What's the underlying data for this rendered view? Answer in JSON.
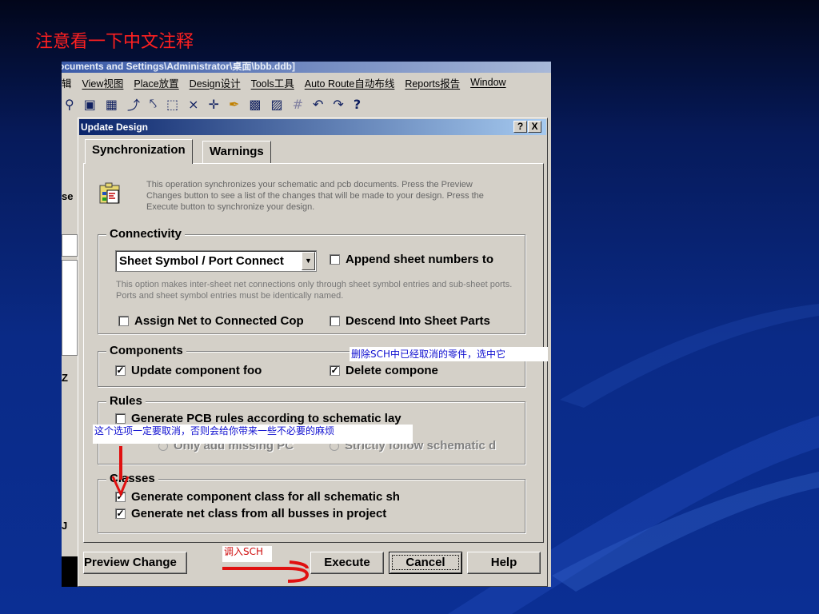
{
  "slide": {
    "title": "注意看一下中文注释"
  },
  "app": {
    "title_path": "ocuments and Settings\\Administrator\\桌面\\bbb.ddb]",
    "menu": [
      "辑",
      "View视图",
      "Place放置",
      "Design设计",
      "Tools工具",
      "Auto Route自动布线",
      "Reports报告",
      "Window"
    ],
    "left_tabs": [
      "se",
      "Z",
      "J"
    ]
  },
  "dialog": {
    "title": "Update Design",
    "help_btn": "?",
    "close_btn": "X",
    "tabs": [
      "Synchronization",
      "Warnings"
    ],
    "intro": "This operation synchronizes your schematic and pcb documents.  Press the Preview Changes button to see a list of the changes that will be made to your design.  Press the Execute button to synchronize your design.",
    "connectivity": {
      "legend": "Connectivity",
      "dropdown_value": "Sheet Symbol / Port Connect",
      "append_sheet": "Append sheet numbers to",
      "note": "This option makes inter-sheet net connections only through sheet symbol entries and sub-sheet ports. Ports and sheet symbol entries must be identically named.",
      "assign_net": "Assign Net to Connected Cop",
      "descend": "Descend Into Sheet Parts"
    },
    "components": {
      "legend": "Components",
      "update_footprint": "Update component foo",
      "delete_components": "Delete compone"
    },
    "rules": {
      "legend": "Rules",
      "generate_pcb_rules": "Generate PCB rules according to schematic lay",
      "only_missing": "Only add missing PC",
      "strictly_follow": "Strictly follow schematic d"
    },
    "classes": {
      "legend": "Classes",
      "component_class": "Generate component class for all schematic sh",
      "net_class": "Generate net class from all busses in project"
    },
    "buttons": {
      "preview": "Preview Change",
      "execute": "Execute",
      "cancel": "Cancel",
      "help": "Help"
    }
  },
  "annotations": {
    "delete_note": "删除SCH中已经取消的零件，选中它",
    "rules_note": "这个选项一定要取消，否则会给你带来一些不必要的麻烦",
    "sch_note": "调入SCH"
  },
  "colors": {
    "annotation_arrow": "#e01010",
    "annotation_text": "#1010d0",
    "slide_title": "#ff2020"
  }
}
